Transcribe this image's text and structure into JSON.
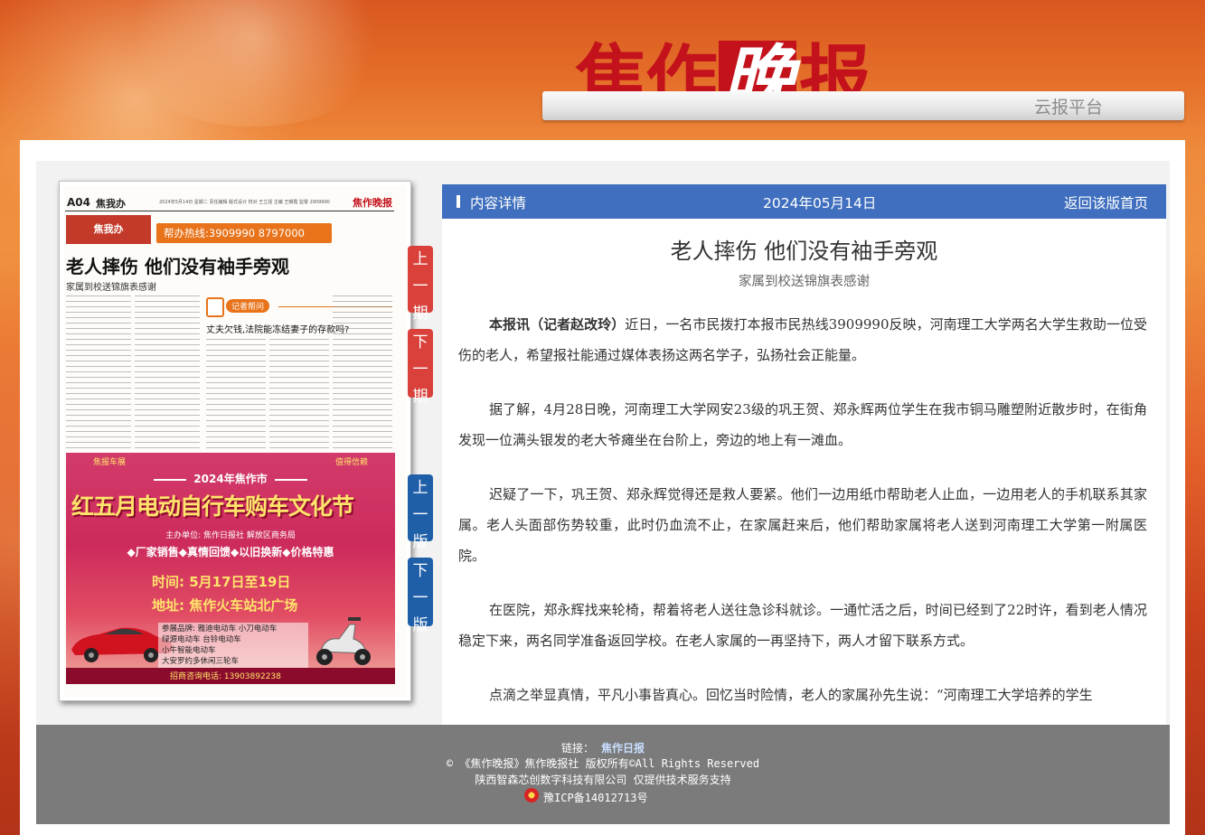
{
  "header": {
    "logo_text_a": "焦作",
    "logo_text_b": "晚",
    "logo_text_c": "报",
    "platform": "云报平台"
  },
  "newspaper": {
    "page": "A04",
    "section": "焦我办",
    "meta_line": "2024年5月14日 星期二 责任编辑 版式设计 校对 王立强 主编 王朝霞 监督 2909990",
    "brand": "焦作晚报",
    "badge": "焦我办",
    "hotline": "帮办热线:3909990 8797000",
    "headline": "老人摔伤 他们没有袖手旁观",
    "subhead": "家属到校送锦旗表感谢",
    "qa_tag": "记者帮问",
    "qa_question": "丈夫欠钱,法院能冻结妻子的存款吗?",
    "ad": {
      "top_left": "焦报车展",
      "top_right": "值得信赖",
      "year_line": "2024年焦作市",
      "main": "红五月电动自行车购车文化节",
      "organizers": "主办单位: 焦作日报社  解放区商务局",
      "features": "◆厂家销售◆真情回馈◆以旧换新◆价格特惠",
      "time": "时间: 5月17日至19日",
      "address": "地址: 焦作火车站北广场",
      "brands_l1": "参展品牌: 雅迪电动车  小刀电动车",
      "brands_l2": "绿源电动车  台铃电动车",
      "brands_l3": "小牛智能电动车",
      "brands_l4": "大安罗约多休闲三轮车",
      "contact": "招商咨询电话: 13903892238"
    }
  },
  "nav": {
    "prev_issue": "上一期",
    "next_issue": "下一期",
    "prev_page": "上一版",
    "next_page": "下一版"
  },
  "article": {
    "bar_label": "内容详情",
    "date": "2024年05月14日",
    "back_link": "返回该版首页",
    "title": "老人摔伤 他们没有袖手旁观",
    "subtitle": "家属到校送锦旗表感谢",
    "lead_bold": "本报讯（记者赵改玲）",
    "lead_rest": "近日，一名市民拨打本报市民热线3909990反映，河南理工大学两名大学生救助一位受伤的老人，希望报社能通过媒体表扬这两名学子，弘扬社会正能量。",
    "p2": "据了解，4月28日晚，河南理工大学网安23级的巩王贺、郑永辉两位学生在我市铜马雕塑附近散步时，在街角发现一位满头银发的老大爷瘫坐在台阶上，旁边的地上有一滩血。",
    "p3": "迟疑了一下，巩王贺、郑永辉觉得还是救人要紧。他们一边用纸巾帮助老人止血，一边用老人的手机联系其家属。老人头面部伤势较重，此时仍血流不止，在家属赶来后，他们帮助家属将老人送到河南理工大学第一附属医院。",
    "p4": "在医院，郑永辉找来轮椅，帮着将老人送往急诊科就诊。一通忙活之后，时间已经到了22时许，看到老人情况稳定下来，两名同学准备返回学校。在老人家属的一再坚持下，两人才留下联系方式。",
    "p5": "点滴之举显真情，平凡小事皆真心。回忆当时险情，老人的家属孙先生说：“河南理工大学培养的学生"
  },
  "footer": {
    "links_label": "链接：",
    "link1": "焦作日报",
    "copyright": "© 《焦作晚报》焦作晚报社   版权所有©All Rights Reserved",
    "support": "陕西智森芯创数字科技有限公司 仅提供技术服务支持",
    "icp": "豫ICP备14012713号"
  }
}
